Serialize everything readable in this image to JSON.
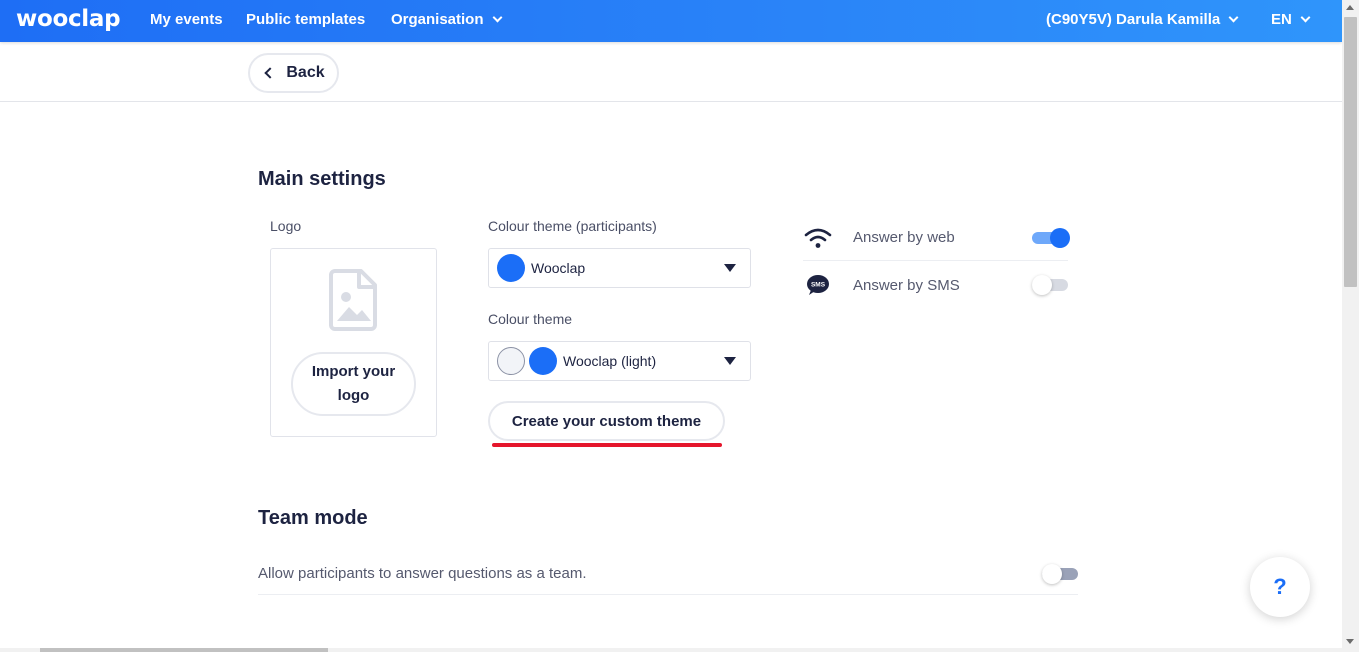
{
  "navbar": {
    "logo": "wooclap",
    "links": [
      "My events",
      "Public templates",
      "Organisation"
    ],
    "user": "(C90Y5V) Darula Kamilla",
    "language": "EN"
  },
  "back_button": {
    "label": "Back"
  },
  "main_settings": {
    "title": "Main settings",
    "logo_label": "Logo",
    "import_logo_label": "Import your logo",
    "participants_theme_label": "Colour theme (participants)",
    "participants_theme_value": "Wooclap",
    "theme_label": "Colour theme",
    "theme_value": "Wooclap (light)",
    "custom_theme_button": "Create your custom theme",
    "answer_web_label": "Answer by web",
    "answer_web_enabled": true,
    "answer_sms_label": "Answer by SMS",
    "answer_sms_enabled": false,
    "sms_icon_text": "SMS"
  },
  "team_mode": {
    "title": "Team mode",
    "description": "Allow participants to answer questions as a team.",
    "enabled": false
  },
  "help_button": {
    "label": "?"
  },
  "colors": {
    "brand_blue": "#1b6ef7",
    "navbar_gradient_start": "#1e6ef5",
    "navbar_gradient_end": "#2f95fb",
    "highlight_red": "#e5162c",
    "text_dark": "#1d2341"
  }
}
